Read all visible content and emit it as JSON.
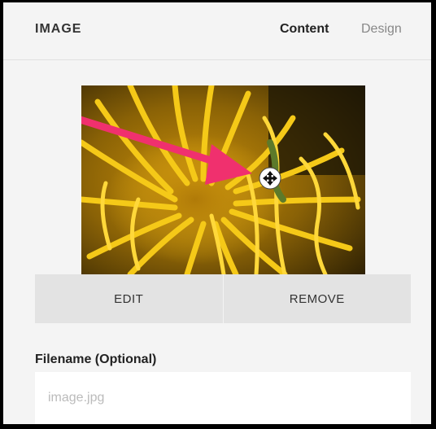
{
  "panel": {
    "title": "IMAGE",
    "tabs": [
      {
        "label": "Content",
        "active": true
      },
      {
        "label": "Design",
        "active": false
      }
    ]
  },
  "image": {
    "subject": "yellow-flower-with-caterpillar",
    "annotation_color": "#f0306e",
    "cursor_icon": "move-cursor-icon"
  },
  "actions": {
    "edit_label": "EDIT",
    "remove_label": "REMOVE"
  },
  "filename": {
    "label": "Filename (Optional)",
    "placeholder": "image.jpg",
    "value": ""
  },
  "colors": {
    "panel_bg": "#f4f4f4",
    "button_bg": "#e3e3e3",
    "flower_yellow": "#f2c21a"
  }
}
